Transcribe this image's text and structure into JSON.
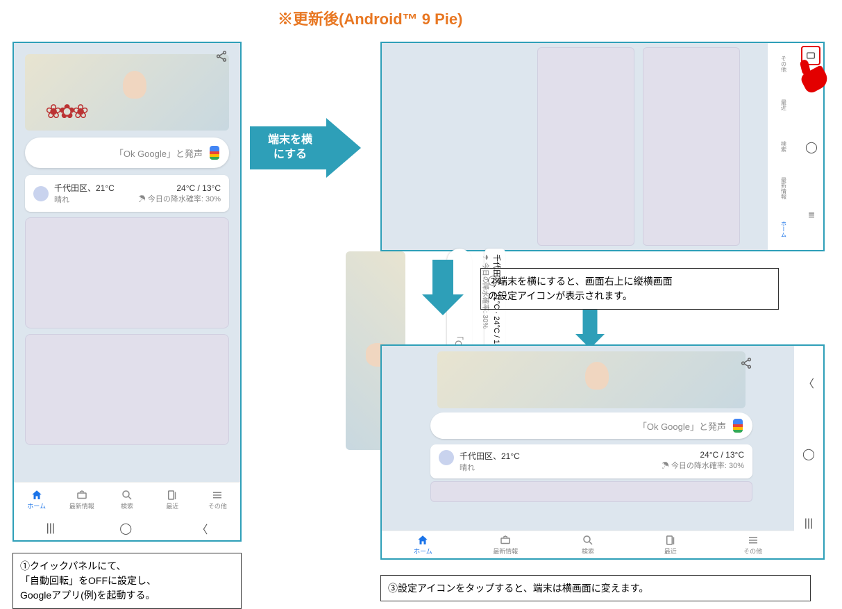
{
  "title": "※更新後(Android™ 9 Pie)",
  "arrow1": "端末を横\nにする",
  "search": {
    "placeholder": "「Ok Google」と発声"
  },
  "weather": {
    "location": "千代田区、21°C",
    "condition": "晴れ",
    "range": "24°C / 13°C",
    "rain": "☂ 今日の降水確率: 30%"
  },
  "tabs": {
    "home": "ホーム",
    "news": "最新情報",
    "search": "検索",
    "recent": "最近",
    "more": "その他"
  },
  "caption1": "①クイックパネルにて、\n「自動回転」をOFFに設定し、\nGoogleアプリ(例)を起動する。",
  "caption2": "②端末を横にすると、画面右上に縦横画面\nの設定アイコンが表示されます。",
  "caption3": "③設定アイコンをタップすると、端末は横画面に変えます。"
}
